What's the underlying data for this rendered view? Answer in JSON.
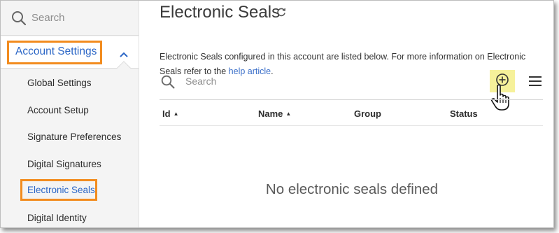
{
  "sidebar": {
    "search_placeholder": "Search",
    "section_label": "Account Settings",
    "items": [
      {
        "label": "Global Settings"
      },
      {
        "label": "Account Setup"
      },
      {
        "label": "Signature Preferences"
      },
      {
        "label": "Digital Signatures"
      },
      {
        "label": "Electronic Seals",
        "selected": true
      },
      {
        "label": "Digital Identity"
      }
    ]
  },
  "main": {
    "title": "Electronic Seals",
    "description_text": "Electronic Seals configured in this account are listed below. For more information on Electronic Seals refer to the ",
    "description_link": "help article",
    "description_end": ".",
    "search_placeholder": "Search",
    "columns": [
      {
        "label": "Id",
        "sort": "▲"
      },
      {
        "label": "Name",
        "sort": "▲"
      },
      {
        "label": "Group",
        "sort": ""
      },
      {
        "label": "Status",
        "sort": ""
      }
    ],
    "empty_message": "No electronic seals defined"
  },
  "icons": {
    "search": "search-icon",
    "chevron": "chevron-up-icon",
    "refresh": "refresh-icon",
    "add": "add-circle-icon",
    "menu": "hamburger-menu-icon",
    "cursor": "hand-pointer-icon"
  },
  "colors": {
    "highlight_border": "#f28c1f",
    "link": "#2b66c6",
    "add_highlight": "#f6f19a"
  }
}
